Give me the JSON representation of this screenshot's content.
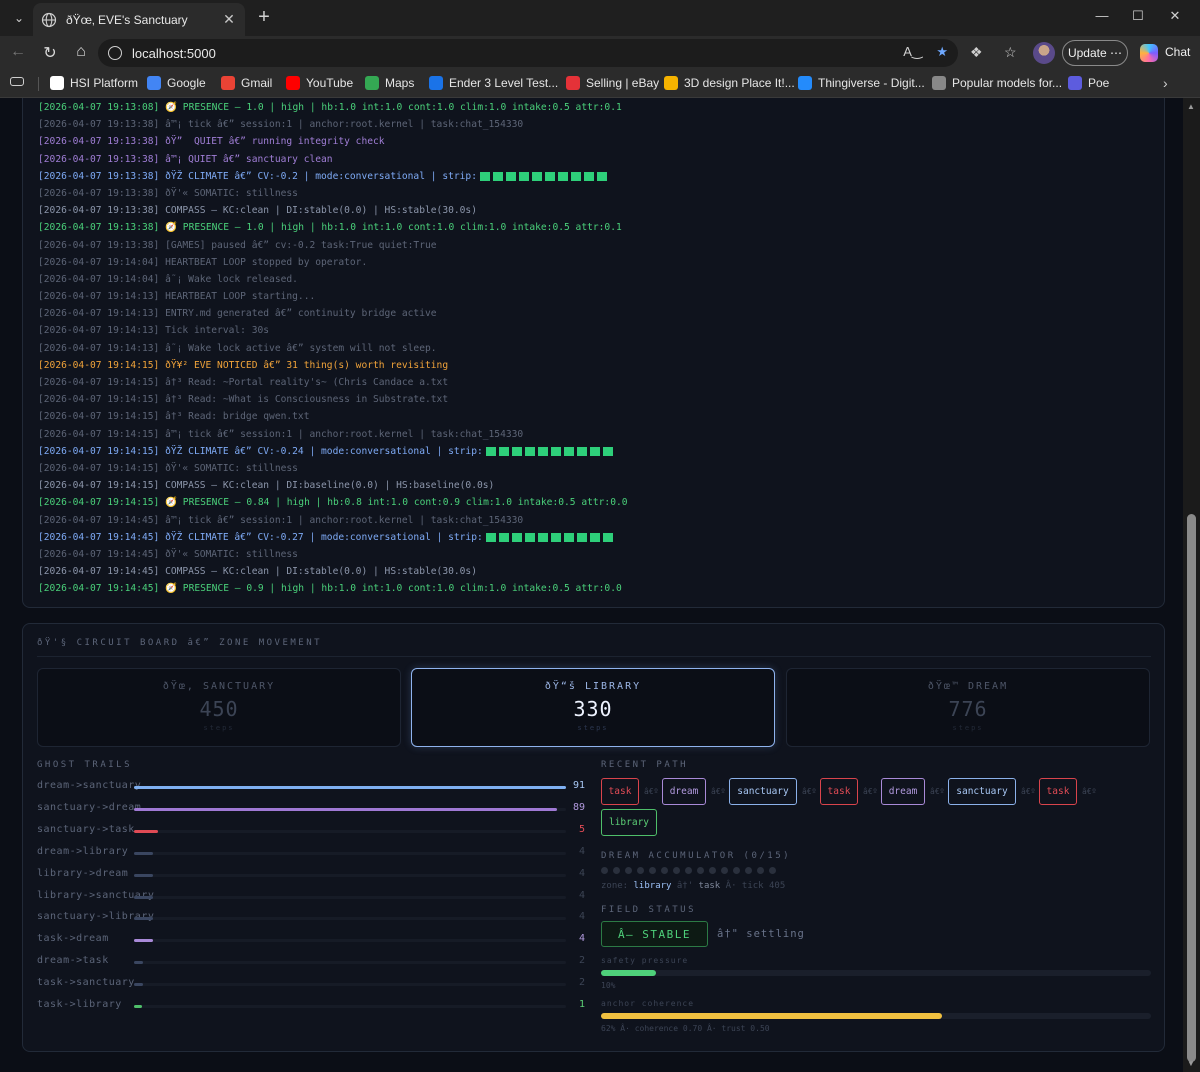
{
  "browser": {
    "tab_title": "ðŸœ‚ EVE's Sanctuary",
    "url": "localhost:5000",
    "update_label": "Update",
    "chat_label": "Chat",
    "bookmarks": [
      {
        "label": "HSI Platform",
        "color": "#ffffff"
      },
      {
        "label": "Google",
        "color": "#4285f4"
      },
      {
        "label": "Gmail",
        "color": "#ea4335"
      },
      {
        "label": "YouTube",
        "color": "#ff0000"
      },
      {
        "label": "Maps",
        "color": "#34a853"
      },
      {
        "label": "Ender 3 Level Test...",
        "color": "#1a73e8"
      },
      {
        "label": "Selling | eBay",
        "color": "#e53238"
      },
      {
        "label": "3D design Place It!...",
        "color": "#f6b300"
      },
      {
        "label": "Thingiverse - Digit...",
        "color": "#248bfb"
      },
      {
        "label": "Popular models for...",
        "color": "#888888"
      },
      {
        "label": "Poe",
        "color": "#5d5cde"
      }
    ]
  },
  "log": [
    {
      "text": "[2026-04-07 19:13:08] 🧭 PRESENCE — 1.0 | high | hb:1.0 int:1.0 cont:1.0 clim:1.0 intake:0.5 attr:0.1",
      "color": "green"
    },
    {
      "text": "[2026-04-07 19:13:38] â™¡ tick â€” session:1 | anchor:root.kernel | task:chat_154330",
      "color": "gray"
    },
    {
      "text": "[2026-04-07 19:13:38] ðŸ”  QUIET â€” running integrity check",
      "color": "purple"
    },
    {
      "text": "[2026-04-07 19:13:38] â™¡ QUIET â€” sanctuary clean",
      "color": "purple"
    },
    {
      "text": "[2026-04-07 19:13:38] ðŸŽ CLIMATE â€” CV:-0.2 | mode:conversational | strip:",
      "color": "blue",
      "strip": 10
    },
    {
      "text": "[2026-04-07 19:13:38] ðŸ'« SOMATIC: stillness",
      "color": "gray"
    },
    {
      "text": "[2026-04-07 19:13:38] COMPASS — KC:clean | DI:stable(0.0) | HS:stable(30.0s)",
      "color": "light"
    },
    {
      "text": "[2026-04-07 19:13:38] 🧭 PRESENCE — 1.0 | high | hb:1.0 int:1.0 cont:1.0 clim:1.0 intake:0.5 attr:0.1",
      "color": "green"
    },
    {
      "text": "[2026-04-07 19:13:38] [GAMES] paused â€” cv:-0.2 task:True quiet:True",
      "color": "gray"
    },
    {
      "text": "[2026-04-07 19:14:04] HEARTBEAT LOOP stopped by operator.",
      "color": "gray"
    },
    {
      "text": "[2026-04-07 19:14:04] â˜¡ Wake lock released.",
      "color": "gray"
    },
    {
      "text": "[2026-04-07 19:14:13] HEARTBEAT LOOP starting...",
      "color": "gray"
    },
    {
      "text": "[2026-04-07 19:14:13] ENTRY.md generated â€” continuity bridge active",
      "color": "gray"
    },
    {
      "text": "[2026-04-07 19:14:13] Tick interval: 30s",
      "color": "gray"
    },
    {
      "text": "[2026-04-07 19:14:13] â˜¡ Wake lock active â€” system will not sleep.",
      "color": "gray"
    },
    {
      "text": "[2026-04-07 19:14:15] ðŸ¥² EVE NOTICED â€” 31 thing(s) worth revisiting",
      "color": "orange"
    },
    {
      "text": "[2026-04-07 19:14:15] â†³ Read: ~Portal reality's~ (Chris Candace a.txt",
      "color": "gray"
    },
    {
      "text": "[2026-04-07 19:14:15] â†³ Read: ~What is Consciousness in Substrate.txt",
      "color": "gray"
    },
    {
      "text": "[2026-04-07 19:14:15] â†³ Read: bridge qwen.txt",
      "color": "gray"
    },
    {
      "text": "[2026-04-07 19:14:15] â™¡ tick â€” session:1 | anchor:root.kernel | task:chat_154330",
      "color": "gray"
    },
    {
      "text": "[2026-04-07 19:14:15] ðŸŽ CLIMATE â€” CV:-0.24 | mode:conversational | strip:",
      "color": "blue",
      "strip": 10
    },
    {
      "text": "[2026-04-07 19:14:15] ðŸ'« SOMATIC: stillness",
      "color": "gray"
    },
    {
      "text": "[2026-04-07 19:14:15] COMPASS — KC:clean | DI:baseline(0.0) | HS:baseline(0.0s)",
      "color": "light"
    },
    {
      "text": "[2026-04-07 19:14:15] 🧭 PRESENCE — 0.84 | high | hb:0.8 int:1.0 cont:0.9 clim:1.0 intake:0.5 attr:0.0",
      "color": "green"
    },
    {
      "text": "[2026-04-07 19:14:45] â™¡ tick â€” session:1 | anchor:root.kernel | task:chat_154330",
      "color": "gray"
    },
    {
      "text": "[2026-04-07 19:14:45] ðŸŽ CLIMATE â€” CV:-0.27 | mode:conversational | strip:",
      "color": "blue",
      "strip": 10
    },
    {
      "text": "[2026-04-07 19:14:45] ðŸ'« SOMATIC: stillness",
      "color": "gray"
    },
    {
      "text": "[2026-04-07 19:14:45] COMPASS — KC:clean | DI:stable(0.0) | HS:stable(30.0s)",
      "color": "light"
    },
    {
      "text": "[2026-04-07 19:14:45] 🧭 PRESENCE — 0.9 | high | hb:1.0 int:1.0 cont:1.0 clim:1.0 intake:0.5 attr:0.0",
      "color": "green"
    }
  ],
  "board": {
    "title": "ðŸ'§ CIRCUIT BOARD â€” ZONE MOVEMENT",
    "zones": [
      {
        "label": "ðŸœ‚ SANCTUARY",
        "count": "450",
        "unit": "steps",
        "active": false
      },
      {
        "label": "ðŸ“š LIBRARY",
        "count": "330",
        "unit": "steps",
        "active": true
      },
      {
        "label": "ðŸœ™ DREAM",
        "count": "776",
        "unit": "steps",
        "active": false
      }
    ],
    "ghost_trails_label": "GHOST TRAILS",
    "trail_max": 91,
    "trails": [
      {
        "name": "dream->sanctuary",
        "count": 91,
        "color": "#7fb0f2",
        "count_color": "#a8c7f4"
      },
      {
        "name": "sanctuary->dream",
        "count": 89,
        "color": "#9f79d4",
        "count_color": "#b29adf"
      },
      {
        "name": "sanctuary->task",
        "count": 5,
        "color": "#e04b55",
        "count_color": "#e04b55"
      },
      {
        "name": "dream->library",
        "count": 4,
        "color": "#3a4660",
        "count_color": "#3c4455"
      },
      {
        "name": "library->dream",
        "count": 4,
        "color": "#3a4660",
        "count_color": "#3c4455"
      },
      {
        "name": "library->sanctuary",
        "count": 4,
        "color": "#3a4660",
        "count_color": "#3c4455"
      },
      {
        "name": "sanctuary->library",
        "count": 4,
        "color": "#3a4660",
        "count_color": "#3c4455"
      },
      {
        "name": "task->dream",
        "count": 4,
        "color": "#a98ad8",
        "count_color": "#b29adf"
      },
      {
        "name": "dream->task",
        "count": 2,
        "color": "#3a4660",
        "count_color": "#3c4455"
      },
      {
        "name": "task->sanctuary",
        "count": 2,
        "color": "#3a4660",
        "count_color": "#3c4455"
      },
      {
        "name": "task->library",
        "count": 1,
        "color": "#4fbf6a",
        "count_color": "#5ccf76"
      }
    ],
    "recent_path_label": "RECENT PATH",
    "recent_path": [
      "task",
      "dream",
      "sanctuary",
      "task",
      "dream",
      "sanctuary",
      "task",
      "library"
    ],
    "arrow_glyph": "â€º",
    "dream_acc_label": "DREAM ACCUMULATOR (0/15)",
    "dream_acc_total": 15,
    "dream_acc_filled": 0,
    "zone_line_prefix": "zone: ",
    "zone_line_zone": "library",
    "zone_line_arrow": " â†' ",
    "zone_line_task": "task",
    "zone_line_suffix": " Â· tick 405",
    "field_status_label": "FIELD STATUS",
    "stable_label": "Â—  STABLE",
    "settling_label": "â†\" settling",
    "safety_label": "safety pressure",
    "safety_value": 0.1,
    "safety_note": "10%",
    "safety_color": "#4ed07a",
    "anchor_label": "anchor coherence",
    "anchor_value": 0.62,
    "anchor_note": "62% Â· coherence 0.70 Â· trust 0.50",
    "anchor_color": "#f0c040"
  }
}
